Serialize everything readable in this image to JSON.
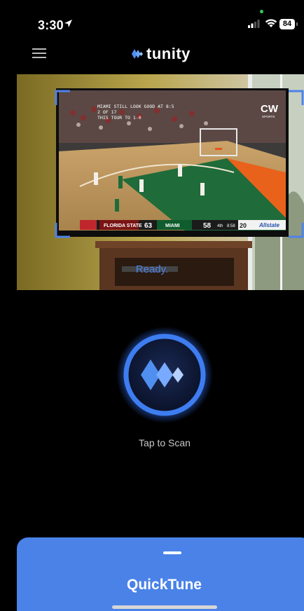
{
  "status_bar": {
    "time": "3:30",
    "battery": "84"
  },
  "header": {
    "brand": "tunity",
    "menu_icon": "hamburger-menu-icon"
  },
  "camera": {
    "status_text": "Ready.",
    "tv_screen": {
      "channel_logo": "CW",
      "channel_sub": "SPORTS",
      "caption_lines": [
        "MIAMI STILL LOOK GOOD AT 8:5",
        "2 OF 17",
        "THIS TOUR TO 1-0"
      ],
      "scoreboard": {
        "away_team": "FLORIDA STATE",
        "away_score": "63",
        "home_team": "MIAMI",
        "home_score": "58",
        "period": "4th",
        "clock": "8:58",
        "shot_clock": "20",
        "sponsor": "Allstate"
      }
    }
  },
  "scan": {
    "label": "Tap to Scan",
    "icon": "tunity-logo-icon"
  },
  "quicktune": {
    "title": "QuickTune"
  },
  "colors": {
    "accent": "#4a82e8",
    "ready_text": "#4f82e8",
    "background": "#000000"
  }
}
